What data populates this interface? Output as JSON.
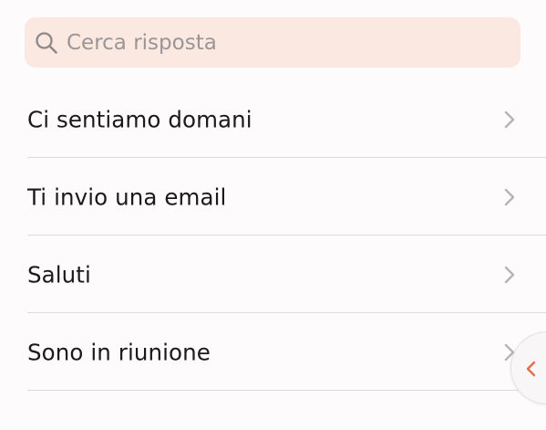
{
  "search": {
    "placeholder": "Cerca risposta",
    "value": "",
    "icon": "search-icon"
  },
  "replies": [
    {
      "label": "Ci sentiamo domani",
      "icon": "chevron-right-icon"
    },
    {
      "label": "Ti invio una email",
      "icon": "chevron-right-icon"
    },
    {
      "label": "Saluti",
      "icon": "chevron-right-icon"
    },
    {
      "label": "Sono in riunione",
      "icon": "chevron-right-icon"
    }
  ],
  "side_handle": {
    "icon": "chevron-left-icon"
  },
  "colors": {
    "background": "#fdfbfb",
    "search_background": "#fbe8e1",
    "placeholder": "#9a9596",
    "text": "#1a1a1a",
    "divider": "#dcdadb",
    "chevron": "#b6b3b4",
    "accent": "#e0704a"
  }
}
